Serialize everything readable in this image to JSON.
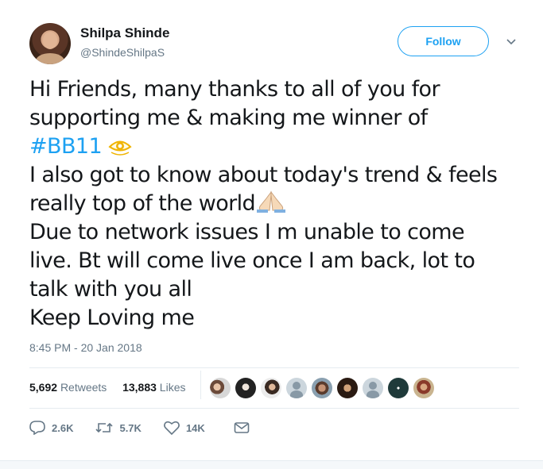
{
  "author": {
    "name": "Shilpa Shinde",
    "handle": "@ShindeShilpaS"
  },
  "follow_button": {
    "label": "Follow"
  },
  "tweet": {
    "line1": "Hi Friends, many thanks to all of you for",
    "line2": "supporting me & making me winner of",
    "hashtag": "#BB11",
    "line4": "I also got to know about today's trend & feels",
    "line5": "really top of the world",
    "line6": "Due to network issues I m unable to come",
    "line7": "live. Bt will come live once I am back, lot to",
    "line8": "talk with you all",
    "line9": "Keep Loving me",
    "emojis": [
      "eye-emoji",
      "folded-hands-emoji"
    ]
  },
  "timestamp": "8:45 PM - 20 Jan 2018",
  "stats": {
    "retweets_count": "5,692",
    "retweets_label": "Retweets",
    "likes_count": "13,883",
    "likes_label": "Likes"
  },
  "likers": [
    "liker-avatar",
    "liker-avatar",
    "liker-avatar",
    "default-avatar",
    "liker-avatar",
    "liker-avatar",
    "default-avatar",
    "liker-avatar",
    "liker-avatar"
  ],
  "actions": {
    "reply_count": "2.6K",
    "retweet_count": "5.7K",
    "like_count": "14K"
  },
  "colors": {
    "accent": "#1da1f2",
    "muted": "#657786",
    "text": "#14171a",
    "divider": "#e6ecf0"
  }
}
